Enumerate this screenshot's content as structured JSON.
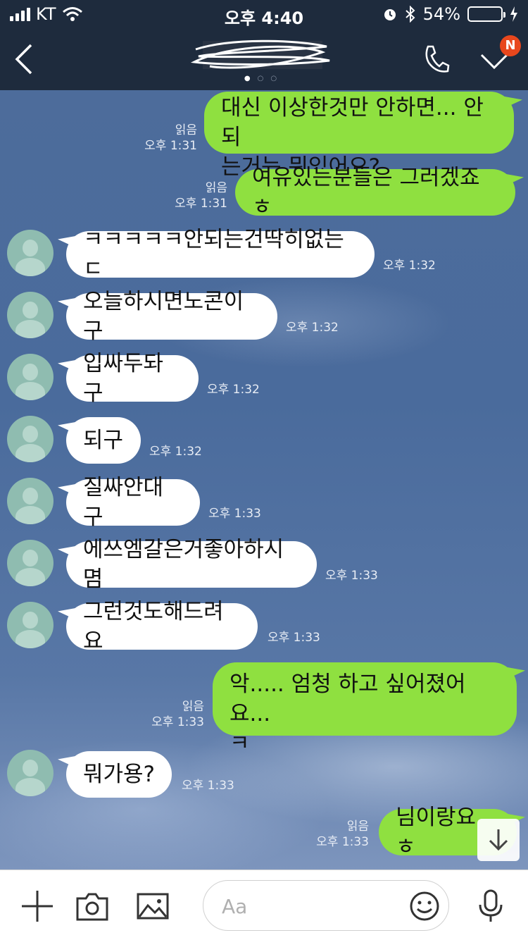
{
  "status_bar": {
    "carrier": "KT",
    "time": "오후 4:40",
    "battery": "54%",
    "battery_level": 0.54
  },
  "header": {
    "title": "",
    "page_dots": 3,
    "active_dot": 0,
    "notification_badge": "N"
  },
  "messages": [
    {
      "side": "out",
      "lines": [
        "대신 이상한것만 안하면...  안되",
        "는거는 뭐있어요?"
      ],
      "read": "읽음",
      "time": "오후 1:31"
    },
    {
      "side": "out",
      "lines": [
        "여유있는분들은 그러겠죠 ㅎ"
      ],
      "read": "읽음",
      "time": "오후 1:31"
    },
    {
      "side": "in",
      "lines": [
        "ㅋㅋㅋㅋㅋ안되는건딱히없는ㄷ"
      ],
      "time": "오후 1:32"
    },
    {
      "side": "in",
      "lines": [
        "오늘하시면노콘이구"
      ],
      "time": "오후 1:32"
    },
    {
      "side": "in",
      "lines": [
        "입싸두돠구"
      ],
      "time": "오후 1:32"
    },
    {
      "side": "in",
      "lines": [
        "되구"
      ],
      "time": "오후 1:32"
    },
    {
      "side": "in",
      "lines": [
        "질싸안대구"
      ],
      "time": "오후 1:33"
    },
    {
      "side": "in",
      "lines": [
        "에쓰엠갈은거좋아하시몀"
      ],
      "time": "오후 1:33"
    },
    {
      "side": "in",
      "lines": [
        "그런것도해드려요"
      ],
      "time": "오후 1:33"
    },
    {
      "side": "out",
      "lines": [
        "악..... 엄청 하고 싶어졌어요...",
        "ㅋ"
      ],
      "read": "읽음",
      "time": "오후 1:33"
    },
    {
      "side": "in",
      "lines": [
        "뭐가용?"
      ],
      "time": "오후 1:33"
    },
    {
      "side": "out",
      "lines": [
        "님이랑요 ㅎ"
      ],
      "read": "읽음",
      "time": "오후 1:33"
    }
  ],
  "input": {
    "placeholder": "Aa"
  },
  "colors": {
    "header_bg": "#1e2b3d",
    "out_bubble": "#8fe040",
    "in_bubble": "#ffffff",
    "badge": "#e8471d"
  }
}
